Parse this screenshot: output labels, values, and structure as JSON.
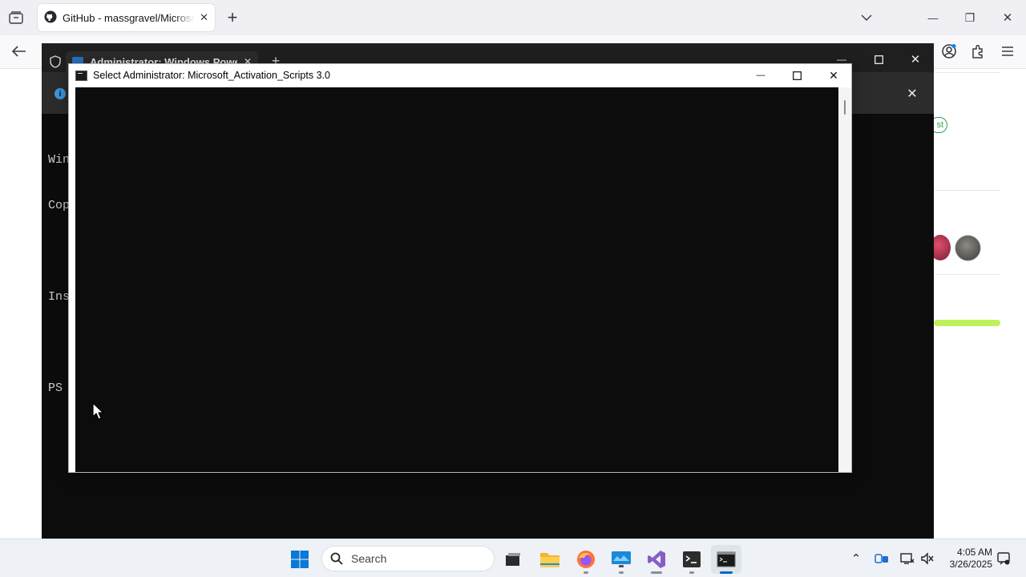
{
  "browser": {
    "tab_title": "GitHub - massgravel/Microsoft-Activation-Scripts",
    "new_tab_symbol": "+",
    "list_tabs_symbol": "⌄",
    "minimize_symbol": "—",
    "restore_symbol": "❐",
    "close_symbol": "✕",
    "page_badge_text": "st"
  },
  "terminal": {
    "tab_title": "Administrator: Windows PowerShell",
    "new_tab_symbol": "+",
    "dropdown_symbol": "⌄",
    "info_symbol": "i",
    "close_bar_symbol": "✕",
    "lines": [
      "Win",
      "Cop",
      "",
      "Ins",
      "",
      "PS"
    ]
  },
  "console": {
    "title": "Select Administrator:  Microsoft_Activation_Scripts 3.0",
    "minimize_symbol": "—",
    "maximize_symbol": "☐",
    "close_symbol": "✕"
  },
  "taskbar": {
    "search_placeholder": "Search",
    "apps": [
      "start",
      "search",
      "task-view",
      "file-explorer",
      "firefox",
      "remote-desktop",
      "visual-studio",
      "windows-terminal",
      "command-prompt"
    ],
    "tray_chevron": "⌃",
    "clock": {
      "time": "4:05 AM",
      "date": "3/26/2025"
    }
  },
  "colors": {
    "accent": "#0067c0",
    "console_bg": "#0c0c0c",
    "progress_green": "#bff15a"
  }
}
